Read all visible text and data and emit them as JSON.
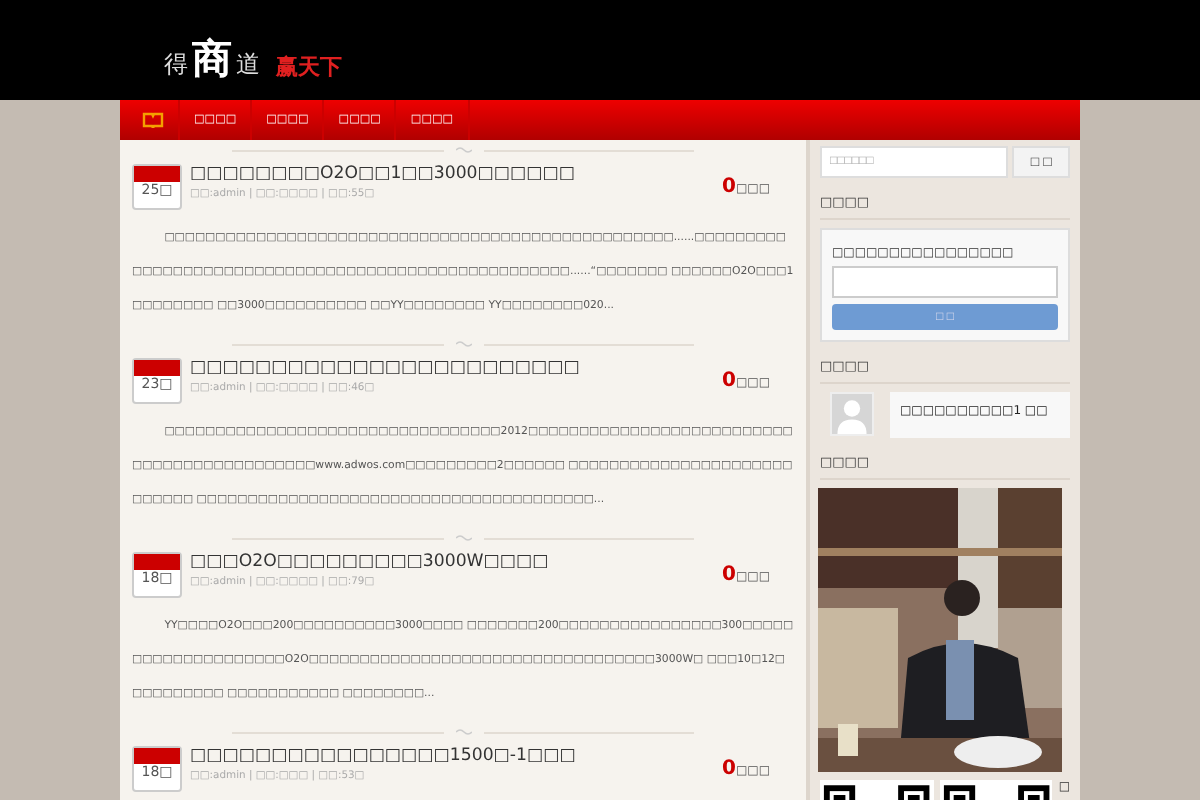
{
  "logo": {
    "left": "得",
    "main": "商",
    "right": "道",
    "slogan": "赢天下"
  },
  "nav": [
    {
      "kind": "home",
      "selected": true
    },
    {
      "kind": "text",
      "label": "□□□□",
      "selected": false
    },
    {
      "kind": "text",
      "label": "□□□□",
      "selected": false
    },
    {
      "kind": "text",
      "label": "□□□□",
      "selected": false
    },
    {
      "kind": "text",
      "label": "□□□□",
      "selected": false
    }
  ],
  "posts": [
    {
      "day": "25□",
      "title": "□□□□□□□□O2O□□1□□3000□□□□□□",
      "meta": "□□:admin | □□:□□□□ | □□:55□",
      "count": "0",
      "count_label": "□□□",
      "excerpt": "□□□□□□□□□□□□□□□□□□□□□□□□□□□□□□□□□□□□□□□□□□□□□□□□□□......□□□□□□□□□□□□□□□□□□□□□□□□□□□□□□□□□□□□□□□□□□□□□□□□□□□□......“□□□□□□□ □□□□□□O2O□□□1□□□□□□□□ □□3000□□□□□□□□□□ □□YY□□□□□□□□ YY□□□□□□□□020..."
    },
    {
      "day": "23□",
      "title": "□□□□□□□□□□□□□□□□□□□□□□□□",
      "meta": "□□:admin | □□:□□□□ | □□:46□",
      "count": "0",
      "count_label": "□□□",
      "excerpt": "□□□□□□□□□□□□□□□□□□□□□□□□□□□□□□□□□2012□□□□□□□□□□□□□□□□□□□□□□□□□□□□□□□□□□□□□□□□□□□□www.adwos.com□□□□□□□□□2□□□□□□ □□□□□□□□□□□□□□□□□□□□□□□□□□□□ □□□□□□□□□□□□□□□□□□□□□□□□□□□□□□□□□□□□□□□..."
    },
    {
      "day": "18□",
      "title": "□□□O2O□□□□□□□□□3000W□□□□",
      "meta": "□□:admin | □□:□□□□ | □□:79□",
      "count": "0",
      "count_label": "□□□",
      "excerpt": "YY□□□□O2O□□□200□□□□□□□□□□3000□□□□ □□□□□□□200□□□□□□□□□□□□□□□□300□□□□□□□□□□□□□□□□□□□□O2O□□□□□□□□□□□□□□□□□□□□□□□□□□□□□□□□□□3000W□ □□□10□12□□□□□□□□□□ □□□□□□□□□□□ □□□□□□□□..."
    },
    {
      "day": "18□",
      "title": "□□□□□□□□□□□□□□□□1500□-1□□□",
      "meta": "□□:admin | □□:□□□ | □□:53□",
      "count": "0",
      "count_label": "□□□"
    }
  ],
  "search": {
    "placeholder": "□□□□□□",
    "button": "□ □"
  },
  "subscribe": {
    "title": "□□□□",
    "label": "□□□□□□□□□□□□□□□□",
    "button": "□ □"
  },
  "comments": {
    "title": "□□□□",
    "items": [
      {
        "text": "□□□□□□□□□□1 □□"
      }
    ]
  },
  "photo": {
    "title": "□□□□",
    "qr_note": "□"
  }
}
